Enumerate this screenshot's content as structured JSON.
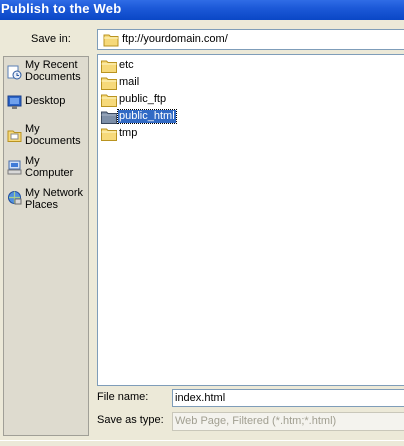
{
  "window": {
    "title": "Publish to the Web"
  },
  "save_in": {
    "label": "Save in:",
    "value": "ftp://yourdomain.com/",
    "icon": "folder-icon"
  },
  "places": [
    {
      "label": "My Recent\nDocuments",
      "icon": "recent-documents-icon"
    },
    {
      "label": "Desktop",
      "icon": "desktop-icon"
    },
    {
      "label": "My\nDocuments",
      "icon": "my-documents-icon"
    },
    {
      "label": "My\nComputer",
      "icon": "my-computer-icon"
    },
    {
      "label": "My Network\nPlaces",
      "icon": "network-places-icon"
    }
  ],
  "folders": [
    {
      "name": "etc",
      "selected": false
    },
    {
      "name": "mail",
      "selected": false
    },
    {
      "name": "public_ftp",
      "selected": false
    },
    {
      "name": "public_html",
      "selected": true
    },
    {
      "name": "tmp",
      "selected": false
    }
  ],
  "file_name": {
    "label": "File name:",
    "value": "index.html"
  },
  "save_as_type": {
    "label": "Save as type:",
    "value": "Web Page, Filtered (*.htm;*.html)"
  },
  "colors": {
    "titlebar": "#0a47c6",
    "dialog_bg": "#ece9d8",
    "selection": "#316ac5",
    "folder": "#f4d46a"
  }
}
